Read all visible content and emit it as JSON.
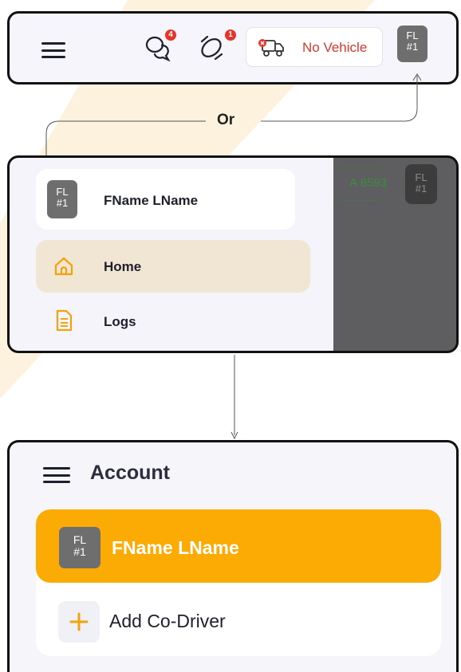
{
  "top_bar": {
    "chat_badge": "4",
    "alert_badge": "1",
    "vehicle_status": "No Vehicle",
    "avatar_initials": "FL",
    "avatar_number": "#1"
  },
  "connector": {
    "or_label": "Or"
  },
  "drawer": {
    "avatar_initials": "FL",
    "avatar_number": "#1",
    "user_name": "FName LName",
    "nav_items": [
      {
        "label": "Home",
        "icon": "home-icon",
        "active": true
      },
      {
        "label": "Logs",
        "icon": "logs-icon",
        "active": false
      }
    ],
    "background_plate": "A 8593",
    "background_avatar_initials": "FL",
    "background_avatar_number": "#1"
  },
  "account": {
    "title": "Account",
    "driver_initials": "FL",
    "driver_number": "#1",
    "driver_name": "FName LName",
    "add_co_driver": "Add Co-Driver"
  },
  "colors": {
    "accent": "#fcab04",
    "home_highlight": "#f1e6d4",
    "badge": "#e5342b",
    "no_vehicle_text": "#d4392e",
    "avatar_bg": "#6e6e6e"
  }
}
